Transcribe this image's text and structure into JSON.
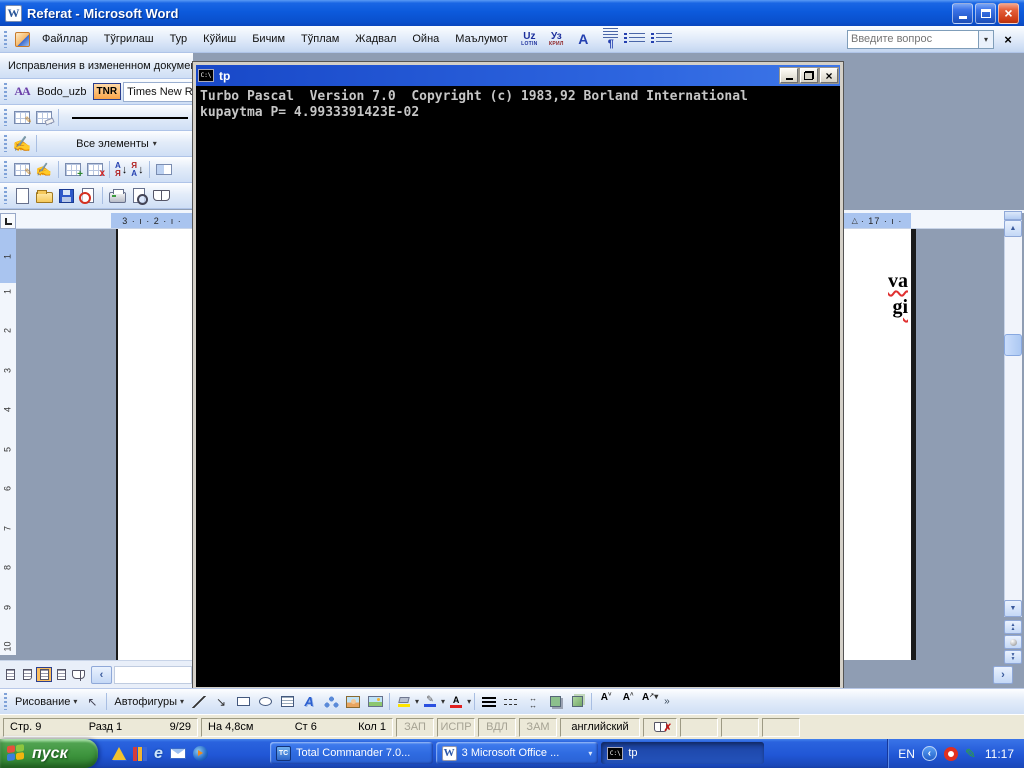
{
  "app": {
    "title": "Referat - Microsoft Word"
  },
  "icons": {
    "word_logo": "W",
    "dropdown": "▾",
    "close_x": "×",
    "uz_lotin_top": "Uz",
    "uz_lotin_bottom": "LOTIN",
    "uz_kril_top": "Уз",
    "uz_kril_bottom": "КРИЛ",
    "letter_a": "A",
    "pilcrow": "¶",
    "aa": "АА",
    "pencil": "✎",
    "writing_hand": "✍",
    "plus": "+",
    "redx": "x",
    "sort1_top": "А",
    "sort1_bottom": "Я",
    "sort2_top": "Я",
    "sort2_bottom": "А",
    "sort_arrow": "↓",
    "console_label": "C:\\",
    "indent_marker": "△",
    "select_arrow": "↖",
    "shape_arrow": "↘",
    "wordart_a": "A",
    "brush": "✎",
    "font_color_a": "А",
    "arrow_lr": "↔",
    "font_small_a": "A",
    "arrow_up": "˄",
    "arrow_down": "˅",
    "arrow_ne": "↗",
    "chevron": "»",
    "chevron_left": "‹",
    "chevron_right": "›",
    "scroll_up": "▲",
    "scroll_down": "▼",
    "ie_e": "e",
    "tc": "TC",
    "spell_x": "✗"
  },
  "menus": {
    "items": [
      "Файллар",
      "Тўгрилаш",
      "Тур",
      "Кўйиш",
      "Бичим",
      "Тўплам",
      "Жадвал",
      "Ойна",
      "Маълумот"
    ]
  },
  "search": {
    "placeholder": "Введите вопрос"
  },
  "review": {
    "display_mode": "Исправления в измененном докумен",
    "show_filter": "Все элементы"
  },
  "format": {
    "style_name": "Bodo_uzb",
    "tnr": "TNR",
    "font_name": "Times New Rom"
  },
  "rulers": {
    "h_left": "3 · ı · 2 · ı ·",
    "h_right": "· 17 · ı ·",
    "v_margin": "1",
    "v": [
      "1",
      "2",
      "3",
      "4",
      "5",
      "6",
      "7",
      "8",
      "9",
      "10"
    ]
  },
  "console": {
    "title": "tp",
    "line1": "Turbo Pascal  Version 7.0  Copyright (c) 1983,92 Borland International",
    "line2": "kupaytma P= 4.9933391423E-02"
  },
  "doc": {
    "frag1": "va",
    "frag2": "gi"
  },
  "drawing": {
    "draw": "Рисование",
    "autoshapes": "Автофигуры"
  },
  "status": {
    "page": "Стр. 9",
    "section": "Разд 1",
    "of": "9/29",
    "at": "На 4,8см",
    "line": "Ст 6",
    "col": "Кол 1",
    "rec": "ЗАП",
    "track": "ИСПР",
    "ext": "ВДЛ",
    "ovr": "ЗАМ",
    "language": "английский"
  },
  "taskbar": {
    "start": "пуск",
    "task_tc": "Total Commander 7.0...",
    "task_office": "3 Microsoft Office ...",
    "task_tp": "tp",
    "lang": "EN",
    "time": "11:17"
  }
}
